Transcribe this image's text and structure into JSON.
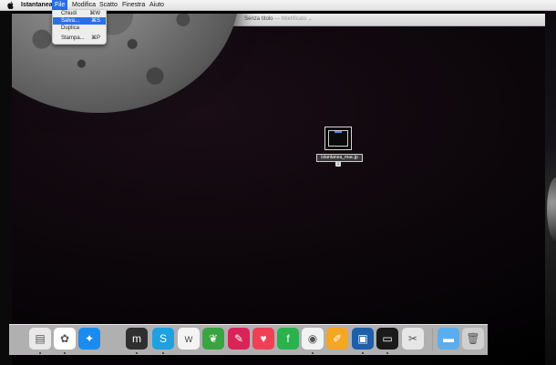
{
  "menubar": {
    "app_name": "Istantanea",
    "menus": [
      "File",
      "Modifica",
      "Scatto",
      "Finestra",
      "Aiuto"
    ],
    "active_menu": "File"
  },
  "file_menu": {
    "items": [
      {
        "label": "Chiudi",
        "shortcut": "⌘W",
        "highlighted": false
      },
      {
        "label": "Salva...",
        "shortcut": "⌘S",
        "highlighted": true
      },
      {
        "label": "Duplica",
        "shortcut": "",
        "highlighted": false
      },
      {
        "label": "Stampa...",
        "shortcut": "⌘P",
        "highlighted": false
      }
    ]
  },
  "window": {
    "title": "Senza titolo",
    "edited_suffix": "— Modificato",
    "buttons": [
      "close",
      "minimize",
      "zoom"
    ]
  },
  "file_icon": {
    "label": "istantanea_mac.jp",
    "tag": "1"
  },
  "dock": {
    "apps": [
      {
        "name": "preview-icon",
        "color": "#e9e9e9",
        "glyph": "▤"
      },
      {
        "name": "photos-icon",
        "color": "#ffffff",
        "glyph": "✿"
      },
      {
        "name": "safari-icon",
        "color": "#1a8cf0",
        "glyph": "✦"
      },
      {
        "name": "mail-icon",
        "color": "#2f2f2f",
        "glyph": "m"
      },
      {
        "name": "skype-icon",
        "color": "#1fa0e0",
        "glyph": "S"
      },
      {
        "name": "writer-icon",
        "color": "#f4f4f4",
        "glyph": "w"
      },
      {
        "name": "evernote-icon",
        "color": "#3aa441",
        "glyph": "❦"
      },
      {
        "name": "scrivener-icon",
        "color": "#d9245a",
        "glyph": "✎"
      },
      {
        "name": "pocket-icon",
        "color": "#ef4056",
        "glyph": "♥"
      },
      {
        "name": "feedly-icon",
        "color": "#2bb24c",
        "glyph": "f"
      },
      {
        "name": "chrome-icon",
        "color": "#f2f2f2",
        "glyph": "◉"
      },
      {
        "name": "pages-icon",
        "color": "#f5a623",
        "glyph": "✐"
      },
      {
        "name": "virtualbox-icon",
        "color": "#1d5fa8",
        "glyph": "▣"
      },
      {
        "name": "terminal-icon",
        "color": "#1a1a1a",
        "glyph": "▭"
      },
      {
        "name": "screenshot-icon",
        "color": "#e6e6e6",
        "glyph": "✂"
      },
      {
        "name": "folder-icon",
        "color": "#5aaef0",
        "glyph": "▬"
      },
      {
        "name": "trash-icon",
        "color": "#d0d0d0",
        "glyph": "🗑"
      }
    ]
  }
}
